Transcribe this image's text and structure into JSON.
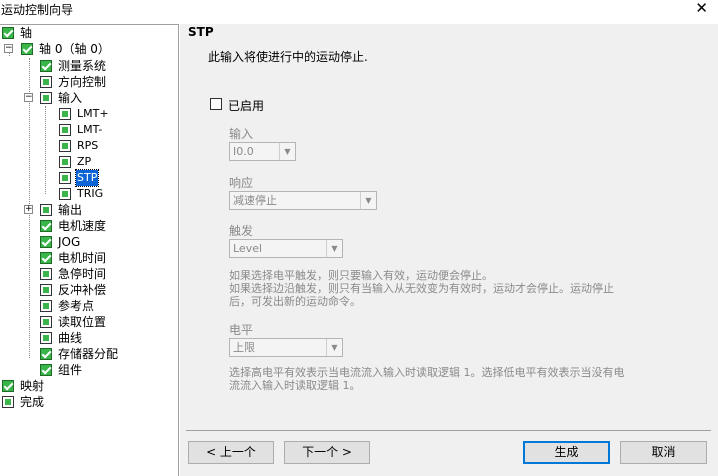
{
  "window": {
    "title": "运动控制向导",
    "close_glyph": "✕"
  },
  "tree": {
    "root_axis": "轴",
    "axis0": "轴 0（轴 0）",
    "measurement": "测量系统",
    "direction": "方向控制",
    "input": "输入",
    "lmt_plus": "LMT+",
    "lmt_minus": "LMT-",
    "rps": "RPS",
    "zp": "ZP",
    "stp": "STP",
    "trig": "TRIG",
    "output": "输出",
    "motor_speed": "电机速度",
    "jog": "JOG",
    "motor_time": "电机时间",
    "estop_time": "急停时间",
    "backlash": "反冲补偿",
    "ref_point": "参考点",
    "read_pos": "读取位置",
    "curve": "曲线",
    "mem_alloc": "存储器分配",
    "component": "组件",
    "mapping": "映射",
    "finish": "完成",
    "expander_minus": "−",
    "expander_plus": "+"
  },
  "panel": {
    "heading": "STP",
    "description": "此输入将使进行中的运动停止.",
    "enabled_label": "已启用",
    "input_label": "输入",
    "input_value": "I0.0",
    "response_label": "响应",
    "response_value": "减速停止",
    "trigger_label": "触发",
    "trigger_value": "Level",
    "trigger_note_1": "如果选择电平触发，则只要输入有效，运动便会停止。",
    "trigger_note_2": "如果选择边沿触发，则只有当输入从无效变为有效时，运动才会停止。运动停止",
    "trigger_note_3": "后，可发出新的运动命令。",
    "level_label": "电平",
    "level_value": "上限",
    "level_note_1": "选择高电平有效表示当电流流入输入时读取逻辑 1。选择低电平有效表示当没有电",
    "level_note_2": "流流入输入时读取逻辑 1。",
    "dropdown_arrow": "▼"
  },
  "buttons": {
    "prev": "< 上一个",
    "next": "下一个 >",
    "generate": "生成",
    "cancel": "取消"
  }
}
